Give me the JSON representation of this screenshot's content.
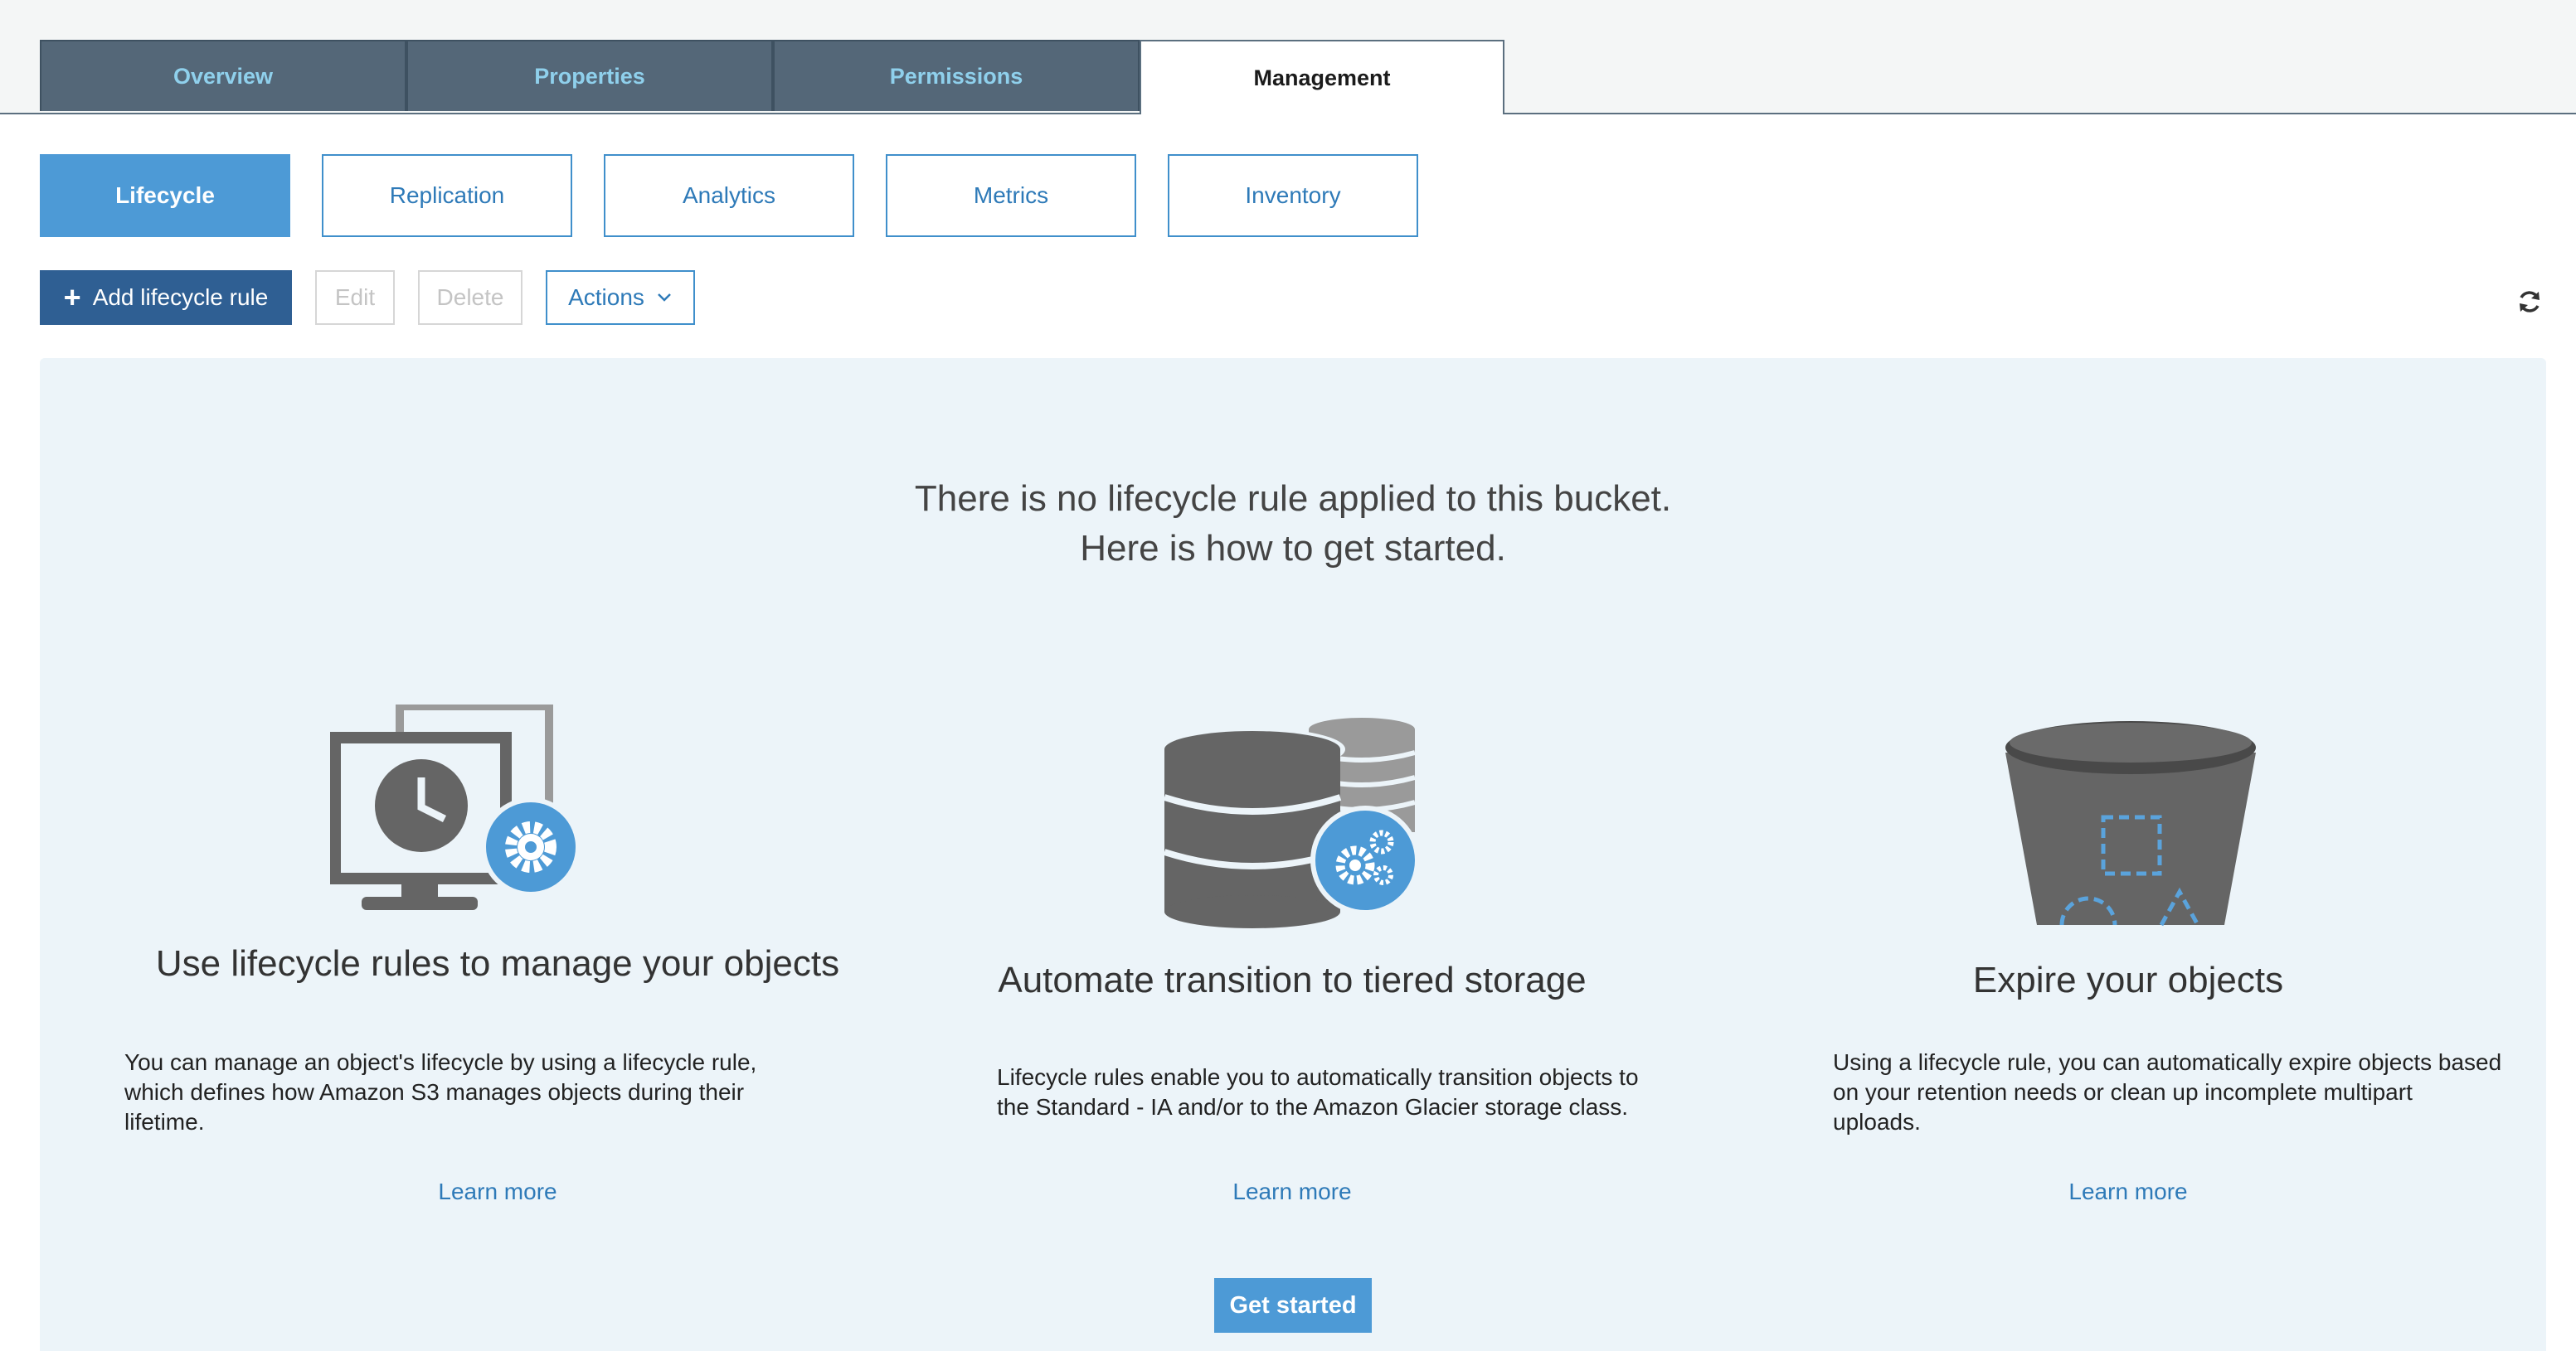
{
  "tabs": [
    {
      "label": "Overview",
      "active": false
    },
    {
      "label": "Properties",
      "active": false
    },
    {
      "label": "Permissions",
      "active": false
    },
    {
      "label": "Management",
      "active": true
    }
  ],
  "subtabs": [
    {
      "label": "Lifecycle",
      "active": true
    },
    {
      "label": "Replication",
      "active": false
    },
    {
      "label": "Analytics",
      "active": false
    },
    {
      "label": "Metrics",
      "active": false
    },
    {
      "label": "Inventory",
      "active": false
    }
  ],
  "toolbar": {
    "add_label": "Add lifecycle rule",
    "edit_label": "Edit",
    "delete_label": "Delete",
    "actions_label": "Actions"
  },
  "empty_state": {
    "headline_line1": "There is no lifecycle rule applied to this bucket.",
    "headline_line2": "Here is how to get started.",
    "cards": [
      {
        "title": "Use lifecycle rules to manage your objects",
        "body": "You can manage an object's lifecycle by using a lifecycle rule, which defines how Amazon S3 manages objects during their lifetime.",
        "link": "Learn more",
        "icon": "monitor-clock-gear-icon"
      },
      {
        "title": "Automate transition to tiered storage",
        "body": "Lifecycle rules enable you to automatically transition objects to the Standard - IA and/or to the Amazon Glacier storage class.",
        "link": "Learn more",
        "icon": "database-gears-icon"
      },
      {
        "title": "Expire your objects",
        "body": "Using a lifecycle rule, you can automatically expire objects based on your retention needs or clean up incomplete multipart uploads.",
        "link": "Learn more",
        "icon": "bucket-objects-icon"
      }
    ],
    "cta_label": "Get started"
  },
  "colors": {
    "tab_bg": "#546778",
    "tab_text": "#8fd0ec",
    "accent": "#4d9ad6",
    "primary_button": "#2f5f93",
    "panel_bg": "#ecf4f9",
    "link": "#2e7ab8"
  }
}
